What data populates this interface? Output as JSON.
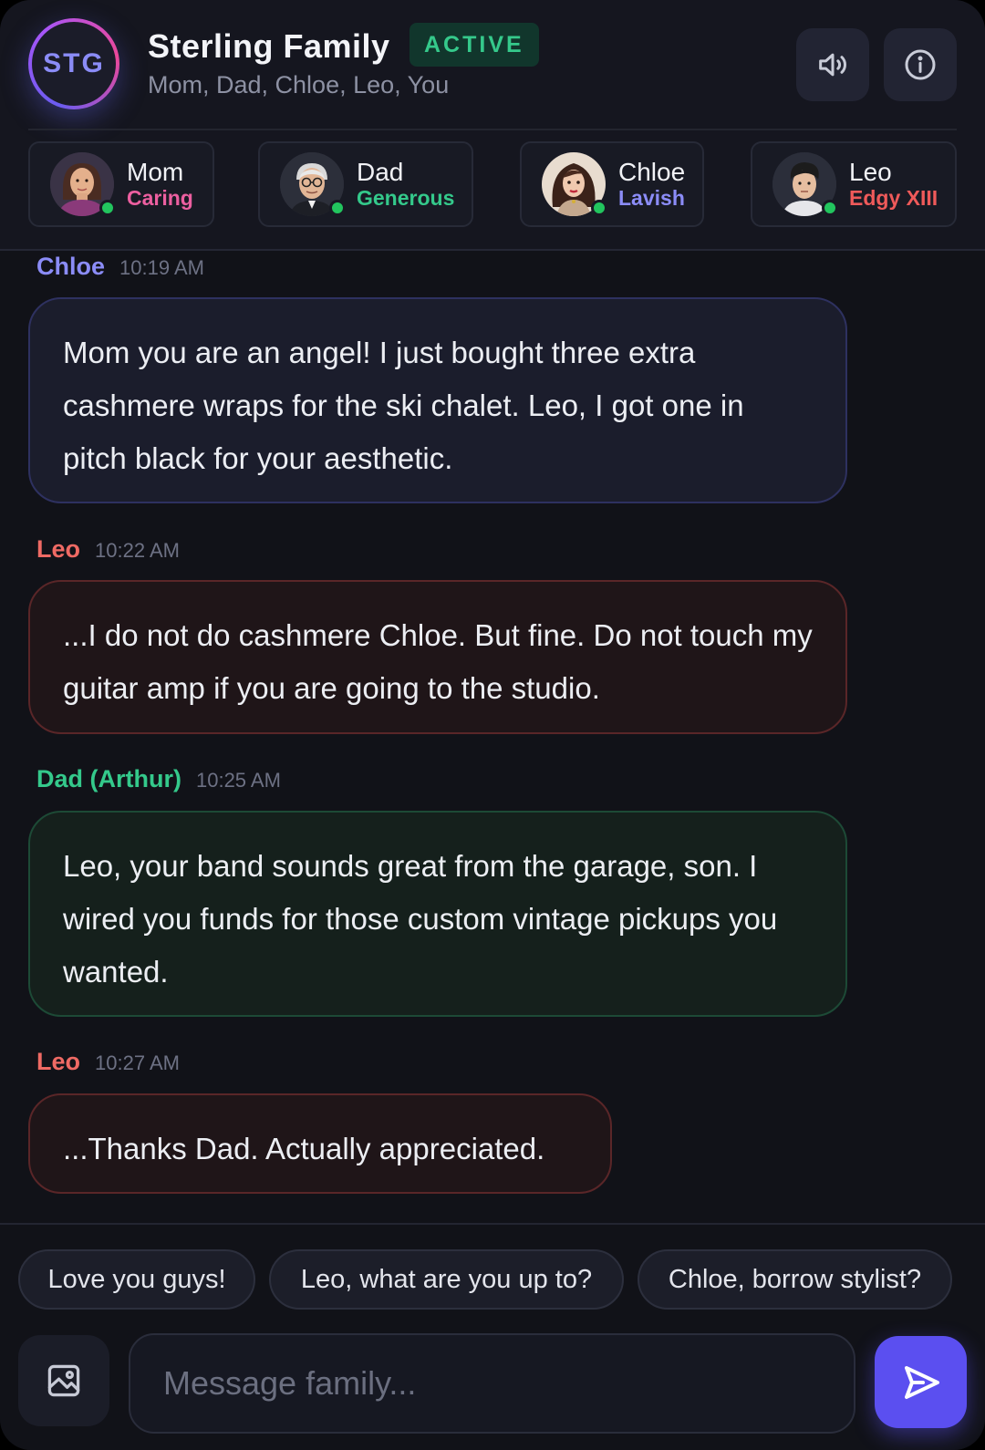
{
  "header": {
    "group_initials": "STG",
    "title": "Sterling Family",
    "status": "ACTIVE",
    "members_line": "Mom, Dad, Chloe, Leo, You",
    "sound_icon": "speaker-icon",
    "info_icon": "info-icon"
  },
  "members": [
    {
      "name": "Mom",
      "trait": "Caring",
      "trait_color": "#ec5fa0",
      "online": true
    },
    {
      "name": "Dad",
      "trait": "Generous",
      "trait_color": "#34c98b",
      "online": true
    },
    {
      "name": "Chloe",
      "trait": "Lavish",
      "trait_color": "#8b8cf7",
      "online": true
    },
    {
      "name": "Leo",
      "trait": "Edgy XIII",
      "trait_color": "#ef5a5a",
      "online": true
    }
  ],
  "messages": [
    {
      "sender": "Chloe",
      "time": "10:19 AM",
      "text": "Mom you are an angel! I just bought three extra cashmere wraps for the ski chalet. Leo, I got one in pitch black for your aesthetic."
    },
    {
      "sender": "Leo",
      "time": "10:22 AM",
      "text": "...I do not do cashmere Chloe. But fine. Do not touch my guitar amp if you are going to the studio."
    },
    {
      "sender": "Dad (Arthur)",
      "time": "10:25 AM",
      "text": "Leo, your band sounds great from the garage, son. I wired you funds for those custom vintage pickups you wanted."
    },
    {
      "sender": "Leo",
      "time": "10:27 AM",
      "text": "...Thanks Dad. Actually appreciated."
    }
  ],
  "sender_colors": {
    "chloe": "#8b8cf7",
    "leo": "#ef6a64",
    "dad": "#34c98b"
  },
  "quick_replies": [
    "Love you guys!",
    "Leo, what are you up to?",
    "Chloe, borrow stylist?"
  ],
  "composer": {
    "placeholder": "Message family...",
    "attach_icon": "image-icon",
    "send_icon": "send-icon"
  }
}
